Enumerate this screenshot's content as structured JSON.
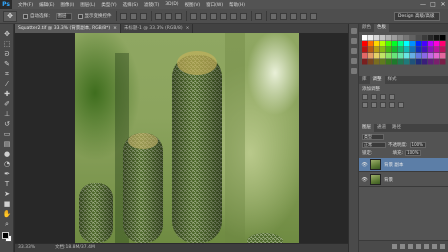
{
  "app": {
    "logo": "Ps"
  },
  "menu": [
    "文件(F)",
    "编辑(E)",
    "图像(I)",
    "图层(L)",
    "类型(Y)",
    "选择(S)",
    "滤镜(T)",
    "3D(D)",
    "视图(V)",
    "窗口(W)",
    "帮助(H)"
  ],
  "window_controls": [
    "—",
    "□",
    "✕"
  ],
  "options": {
    "auto_select_label": "自动选择：",
    "auto_select_value": "图层",
    "transform_label": "显示变换控件",
    "workspace": "Design 高级/高级"
  },
  "document_tabs": [
    {
      "label": "Squatter2.tif @ 33.3% (背景副本, RGB/8*)",
      "active": true,
      "close": "×"
    },
    {
      "label": "未标题-1 @ 33.3% (RGB/8)",
      "active": false,
      "close": "×"
    }
  ],
  "status": {
    "zoom": "33.33%",
    "doc": "文档:18.8M/37.4M"
  },
  "panels": {
    "top_tabs": [
      "颜色",
      "色板"
    ],
    "adjust_tabs": [
      "库",
      "调整",
      "样式"
    ],
    "adjust_title": "添加调整",
    "layer_tabs": [
      "图层",
      "通道",
      "路径"
    ],
    "kind_label": "类型",
    "blend_mode": "正常",
    "opacity_label": "不透明度:",
    "opacity_value": "100%",
    "lock_label": "锁定:",
    "fill_label": "填充:",
    "fill_value": "100%"
  },
  "layers": [
    {
      "name": "背景 副本",
      "selected": true,
      "eye": "👁"
    },
    {
      "name": "背景",
      "selected": false,
      "eye": "👁"
    }
  ],
  "colors": {
    "selection": "#5c7ea7",
    "panel_bg": "#535353"
  }
}
